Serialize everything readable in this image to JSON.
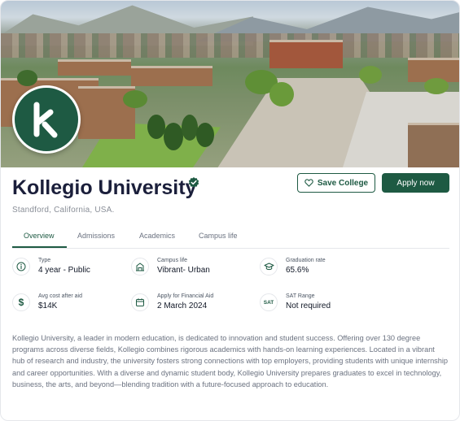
{
  "university": {
    "name": "Kollegio University",
    "location": "Standford, California, USA."
  },
  "actions": {
    "save_label": "Save College",
    "apply_label": "Apply now"
  },
  "tabs": [
    {
      "label": "Overview",
      "active": true
    },
    {
      "label": "Admissions",
      "active": false
    },
    {
      "label": "Academics",
      "active": false
    },
    {
      "label": "Campus life",
      "active": false
    }
  ],
  "stats": {
    "type": {
      "label": "Type",
      "value": "4 year - Public",
      "icon": "info-icon"
    },
    "campus_life": {
      "label": "Campus life",
      "value": "Vibrant- Urban",
      "icon": "building-icon"
    },
    "graduation_rate": {
      "label": "Graduation rate",
      "value": "65.6%",
      "icon": "graduation-cap-icon"
    },
    "avg_cost": {
      "label": "Avg cost after aid",
      "value": "$14K",
      "icon": "dollar-icon"
    },
    "financial_aid": {
      "label": "Apply for Financial Aid",
      "value": "2 March 2024",
      "icon": "calendar-icon"
    },
    "sat_range": {
      "label": "SAT Range",
      "value": "Not required",
      "icon_text": "SAT"
    }
  },
  "description": "Kollegio University, a leader in modern education, is dedicated to innovation and student success. Offering over 130 degree programs across diverse fields, Kollegio combines rigorous academics with hands-on learning experiences. Located in a vibrant hub of research and industry, the university fosters strong connections with top employers, providing students with unique internship and career opportunities. With a diverse and dynamic student body, Kollegio University prepares graduates to excel in technology, business, the arts, and beyond—blending tradition with a future-focused approach to education.",
  "colors": {
    "brand": "#1e5a43",
    "title": "#1b1f3b",
    "muted": "#6b7280"
  }
}
